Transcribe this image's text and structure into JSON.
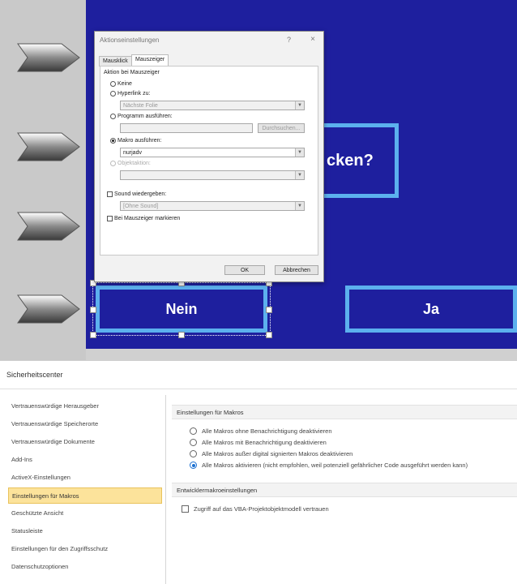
{
  "slide": {
    "question_text": "cken?",
    "no_label": "Nein",
    "yes_label": "Ja"
  },
  "dialog": {
    "title": "Aktionseinstellungen",
    "help": "?",
    "close": "×",
    "tabs": [
      "Mausklick",
      "Mauszeiger"
    ],
    "group_label": "Aktion bei Mauszeiger",
    "options": {
      "keine": "Keine",
      "hyperlink": "Hyperlink zu:",
      "hyperlink_value": "Nächste Folie",
      "programm": "Programm ausführen:",
      "durchsuchen": "Durchsuchen...",
      "makro": "Makro ausführen:",
      "makro_value": "nurjadv",
      "objektaktion": "Objektaktion:",
      "sound": "Sound wiedergeben:",
      "sound_value": "[Ohne Sound]",
      "markieren": "Bei Mauszeiger markieren"
    },
    "ok": "OK",
    "cancel": "Abbrechen"
  },
  "trust_center": {
    "title": "Sicherheitscenter",
    "sidebar": [
      "Vertrauenswürdige Herausgeber",
      "Vertrauenswürdige Speicherorte",
      "Vertrauenswürdige Dokumente",
      "Add-Ins",
      "ActiveX-Einstellungen",
      "Einstellungen für Makros",
      "Geschützte Ansicht",
      "Statusleiste",
      "Einstellungen für den Zugriffsschutz",
      "Datenschutzoptionen"
    ],
    "active_sidebar_index": 5,
    "macro_section": "Einstellungen für Makros",
    "macro_options": [
      "Alle Makros ohne Benachrichtigung deaktivieren",
      "Alle Makros mit Benachrichtigung deaktivieren",
      "Alle Makros außer digital signierten Makros deaktivieren",
      "Alle Makros aktivieren (nicht empfohlen, weil potenziell gefährlicher Code ausgeführt werden kann)"
    ],
    "selected_macro_option": 3,
    "dev_section": "Entwicklermakroeinstellungen",
    "vba_option": "Zugriff auf das VBA-Projektobjektmodell vertrauen"
  }
}
